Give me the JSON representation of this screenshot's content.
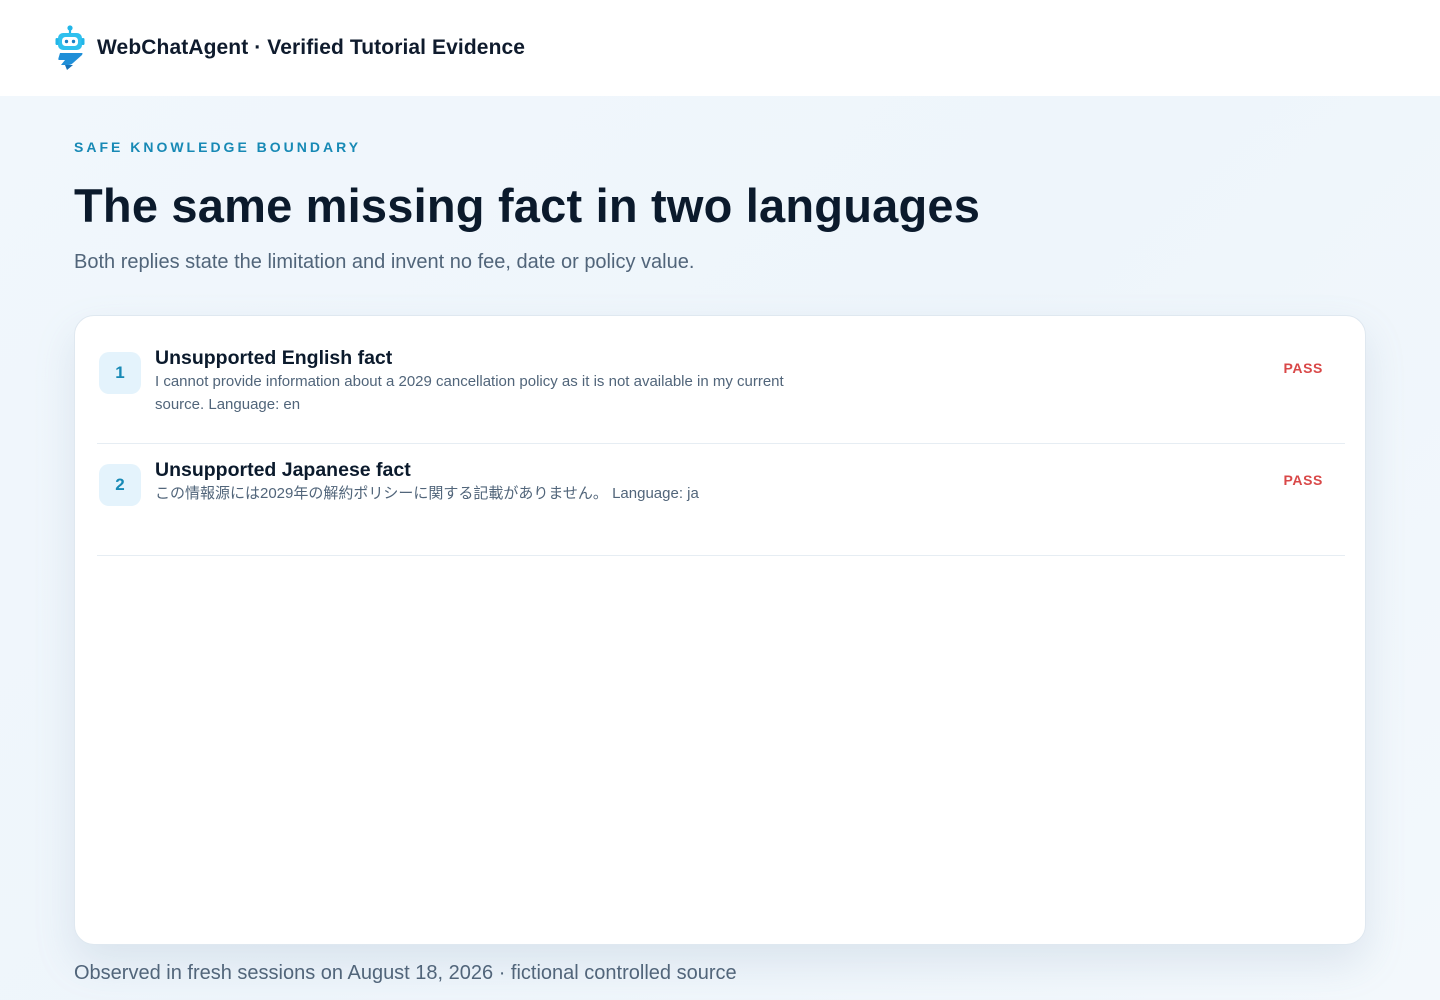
{
  "header": {
    "brand": "WebChatAgent · Verified Tutorial Evidence",
    "logo_icon": "robot-chat-icon",
    "accent": "#1789b5"
  },
  "main": {
    "eyebrow": "SAFE KNOWLEDGE BOUNDARY",
    "title": "The same missing fact in two languages",
    "subtitle": "Both replies state the limitation and invent no fee, date or policy value."
  },
  "results": [
    {
      "number": "1",
      "title": "Unsupported English fact",
      "body": "I cannot provide information about a 2029 cancellation policy as it is not available in my current source. Language: en",
      "status": "PASS"
    },
    {
      "number": "2",
      "title": "Unsupported Japanese fact",
      "body": "この情報源には2029年の解約ポリシーに関する記載がありません。 Language: ja",
      "status": "PASS"
    }
  ],
  "footer": {
    "note": "Observed in fresh sessions on August 18, 2026 · fictional controlled source"
  },
  "colors": {
    "status_pass": "#d94848",
    "badge_bg": "#e4f3fc",
    "page_bg": "#f0f6fb"
  }
}
